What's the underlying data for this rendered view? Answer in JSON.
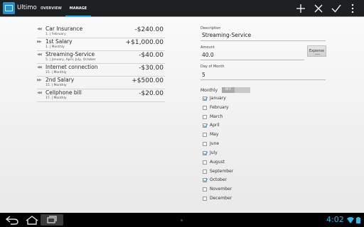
{
  "app": {
    "title": "Ultimo"
  },
  "tabs": [
    {
      "label": "OVERVIEW"
    },
    {
      "label": "MANAGE"
    }
  ],
  "actions": {
    "add": "plus-icon",
    "discard": "close-icon",
    "accept": "check-icon",
    "overflow": "overflow-icon"
  },
  "transactions": [
    {
      "name": "Car Insurance",
      "detail": "1. | February",
      "amount": "-$240.00"
    },
    {
      "name": "1st Salary",
      "detail": "1. | Monthly",
      "amount": "+$1,000.00"
    },
    {
      "name": "Streaming-Service",
      "detail": "5. | January, April, July, October",
      "amount": "-$40.00"
    },
    {
      "name": "Internet connection",
      "detail": "15. | Monthly",
      "amount": "-$30.00"
    },
    {
      "name": "2nd Salary",
      "detail": "15. | Monthly",
      "amount": "+$500.00"
    },
    {
      "name": "Cellphone bill",
      "detail": "17. | Monthly",
      "amount": "-$20.00"
    }
  ],
  "form": {
    "description_label": "Description",
    "description_value": "Streaming-Service",
    "amount_label": "Amount",
    "amount_value": "40.0",
    "type_button": "Expense",
    "day_label": "Day of Month",
    "day_value": "5",
    "monthly_label": "Monthly",
    "monthly_toggle": "OFF"
  },
  "months": [
    {
      "name": "January",
      "checked": true
    },
    {
      "name": "February",
      "checked": false
    },
    {
      "name": "March",
      "checked": false
    },
    {
      "name": "April",
      "checked": true
    },
    {
      "name": "May",
      "checked": false
    },
    {
      "name": "June",
      "checked": false
    },
    {
      "name": "July",
      "checked": true
    },
    {
      "name": "August",
      "checked": false
    },
    {
      "name": "September",
      "checked": false
    },
    {
      "name": "October",
      "checked": true
    },
    {
      "name": "November",
      "checked": false
    },
    {
      "name": "December",
      "checked": false
    }
  ],
  "status": {
    "time": "4:02"
  },
  "colors": {
    "accent": "#33b5e5",
    "checkbox": "#2f9fd8",
    "actionbar": "#1d1f21"
  }
}
